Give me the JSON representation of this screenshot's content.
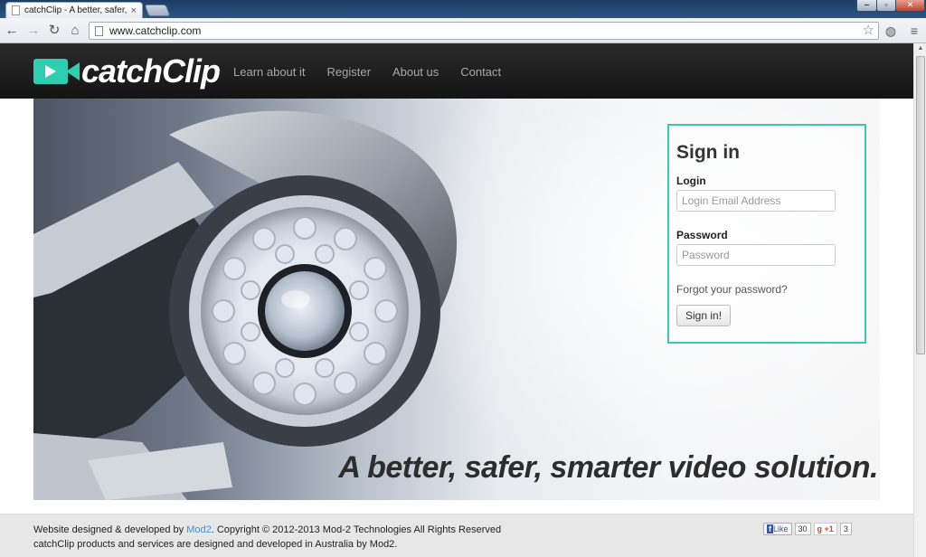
{
  "browser": {
    "tab_title": "catchClip - A better, safer,",
    "tab_close": "×",
    "url": "www.catchclip.com",
    "win_min": "‒",
    "win_max": "▫",
    "win_close": "✕"
  },
  "nav": {
    "logo_text": "catchClip",
    "links": [
      "Learn about it",
      "Register",
      "About us",
      "Contact"
    ]
  },
  "hero": {
    "tagline": "A better, safer, smarter video solution."
  },
  "signin": {
    "title": "Sign in",
    "login_label": "Login",
    "login_placeholder": "Login Email Address",
    "password_label": "Password",
    "password_placeholder": "Password",
    "forgot": "Forgot your password?",
    "button": "Sign in!"
  },
  "footer": {
    "line1_pre": "Website designed & developed by ",
    "line1_link": "Mod2",
    "line1_post": ". Copyright © 2012-2013 Mod-2 Technologies All Rights Reserved",
    "line2": "catchClip products and services are designed and developed in Australia by Mod2."
  },
  "social": {
    "like": "Like",
    "like_count": "30",
    "gplus": "+1",
    "gplus_count": "3"
  },
  "colors": {
    "accent": "#2ecfb0",
    "navbar": "#1c1c1c"
  },
  "icons": [
    "back-icon",
    "forward-icon",
    "reload-icon",
    "home-icon",
    "star-icon",
    "globe-icon",
    "menu-icon"
  ]
}
